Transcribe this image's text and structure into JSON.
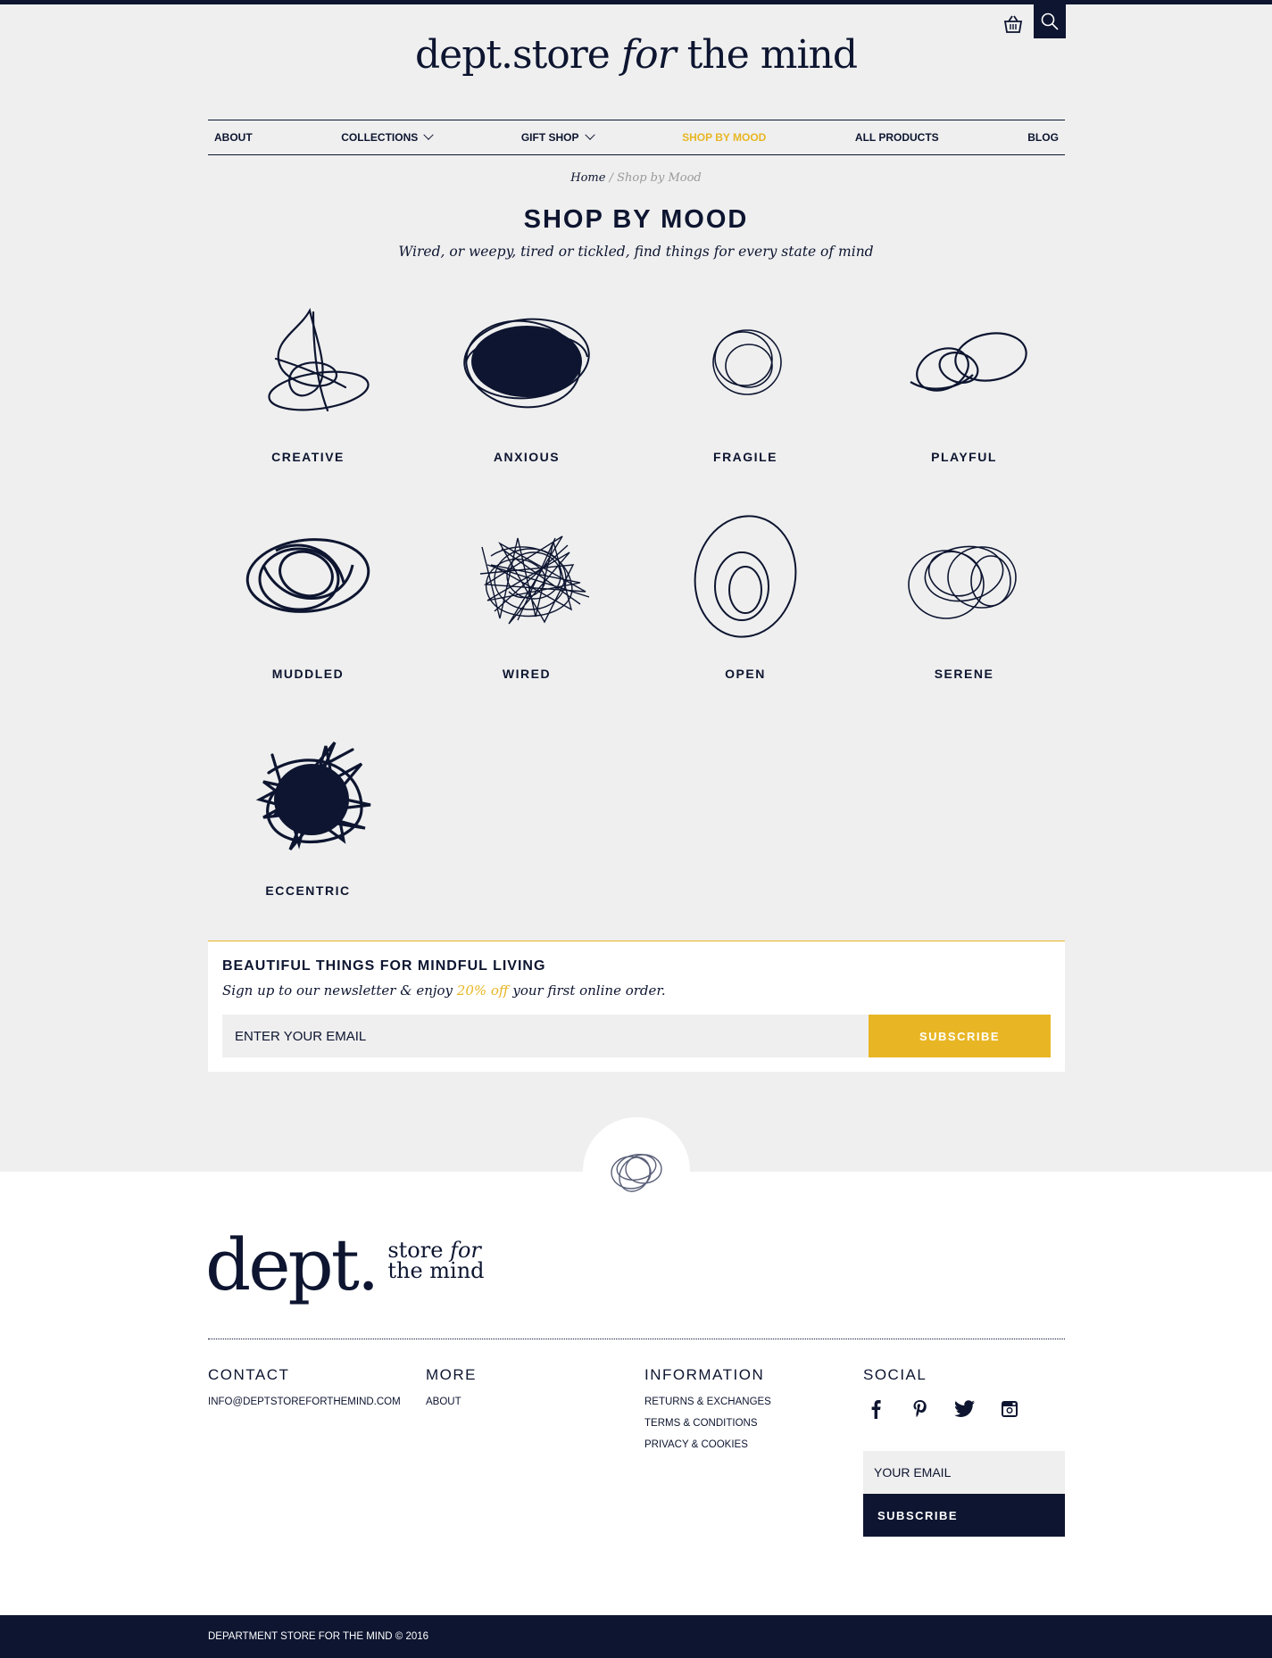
{
  "header": {
    "logo_main": "dept.store",
    "logo_italic": "for",
    "logo_end": "the mind",
    "basket_icon": "basket-icon",
    "search_icon": "search-icon"
  },
  "nav": {
    "items": [
      {
        "label": "ABOUT"
      },
      {
        "label": "COLLECTIONS",
        "has_dropdown": true
      },
      {
        "label": "GIFT SHOP",
        "has_dropdown": true
      },
      {
        "label": "SHOP BY MOOD",
        "active": true
      },
      {
        "label": "ALL PRODUCTS"
      },
      {
        "label": "BLOG"
      }
    ]
  },
  "breadcrumb": {
    "home": "Home",
    "separator": " / ",
    "current": "Shop by Mood"
  },
  "page": {
    "title": "SHOP BY MOOD",
    "subtitle": "Wired, or weepy, tired or tickled, find things for every state of mind"
  },
  "moods": [
    {
      "label": "CREATIVE",
      "icon": "creative-scribble-icon"
    },
    {
      "label": "ANXIOUS",
      "icon": "anxious-scribble-icon"
    },
    {
      "label": "FRAGILE",
      "icon": "fragile-scribble-icon"
    },
    {
      "label": "PLAYFUL",
      "icon": "playful-scribble-icon"
    },
    {
      "label": "MUDDLED",
      "icon": "muddled-scribble-icon"
    },
    {
      "label": "WIRED",
      "icon": "wired-scribble-icon"
    },
    {
      "label": "OPEN",
      "icon": "open-scribble-icon"
    },
    {
      "label": "SERENE",
      "icon": "serene-scribble-icon"
    },
    {
      "label": "ECCENTRIC",
      "icon": "eccentric-scribble-icon"
    }
  ],
  "newsletter": {
    "heading": "BEAUTIFUL THINGS FOR MINDFUL LIVING",
    "text_before": "Sign up to our newsletter & enjoy ",
    "text_accent": "20% off",
    "text_after": " your first online order.",
    "placeholder": "ENTER YOUR EMAIL",
    "button": "SUBSCRIBE"
  },
  "footer": {
    "logo_big": "dept.",
    "logo_small_1": "store",
    "logo_small_italic": "for",
    "logo_small_2": "the mind",
    "contact": {
      "heading": "CONTACT",
      "email": "INFO@DEPTSTOREFORTHEMIND.COM"
    },
    "more": {
      "heading": "MORE",
      "links": [
        "ABOUT"
      ]
    },
    "information": {
      "heading": "INFORMATION",
      "links": [
        "RETURNS & EXCHANGES",
        "TERMS & CONDITIONS",
        "PRIVACY & COOKIES"
      ]
    },
    "social": {
      "heading": "SOCIAL",
      "icons": [
        "facebook-icon",
        "pinterest-icon",
        "twitter-icon",
        "instagram-icon"
      ],
      "placeholder": "YOUR EMAIL",
      "button": "SUBSCRIBE"
    },
    "copyright": "DEPARTMENT STORE FOR THE MIND © 2016"
  },
  "colors": {
    "navy": "#0d1530",
    "accent": "#e8b624",
    "background": "#efefef"
  }
}
